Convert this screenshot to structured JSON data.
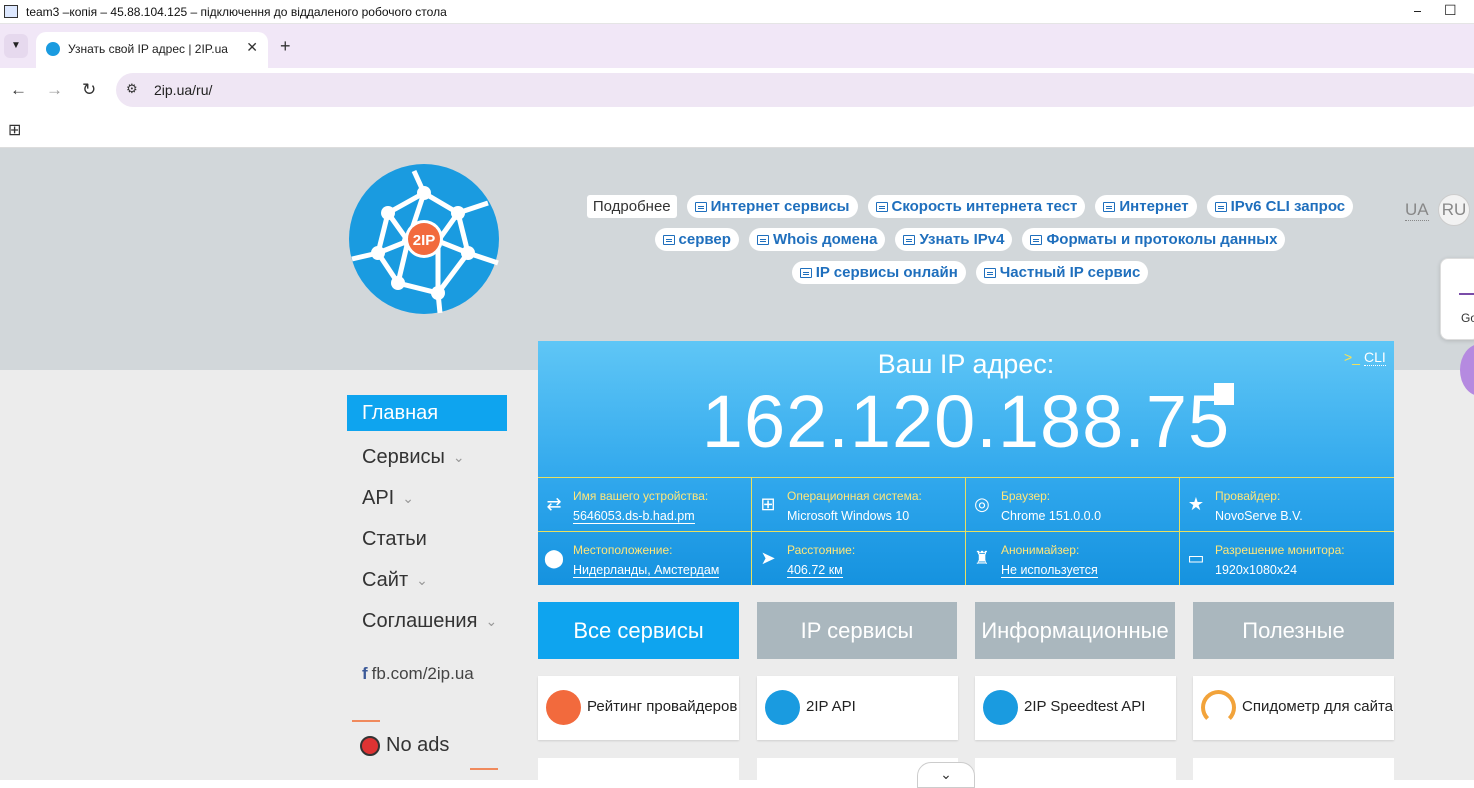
{
  "window": {
    "title": "team3 –копія – 45.88.104.125 – підключення до віддаленого робочого стола",
    "controls": [
      "⎯",
      "☐"
    ]
  },
  "browser": {
    "tab_title": "Узнать свой IP адрес | 2IP.ua",
    "tab_close": "✕",
    "new_tab": "+",
    "url": "2ip.ua/ru/",
    "back": "←",
    "forward": "→",
    "reload": "↻",
    "side_panel_text": "Go"
  },
  "header": {
    "logo_text": "2IP",
    "nav_rows": [
      [
        {
          "label": "Подробнее",
          "plain": true
        },
        {
          "label": "Интернет сервисы"
        },
        {
          "label": "Скорость интернета тест"
        },
        {
          "label": "Интернет"
        },
        {
          "label": "IPv6 CLI запрос"
        }
      ],
      [
        {
          "label": "сервер"
        },
        {
          "label": "Whois домена"
        },
        {
          "label": "Узнать IPv4"
        },
        {
          "label": "Форматы и протоколы данных"
        }
      ],
      [
        {
          "label": "IP сервисы онлайн"
        },
        {
          "label": "Частный IP сервис"
        }
      ]
    ],
    "lang_ua": "UA",
    "lang_ru": "RU"
  },
  "sidebar": {
    "items": [
      {
        "label": "Главная",
        "active": true,
        "chevron": false
      },
      {
        "label": "Сервисы",
        "chevron": true
      },
      {
        "label": "API",
        "chevron": true
      },
      {
        "label": "Статьи",
        "chevron": false
      },
      {
        "label": "Сайт",
        "chevron": true
      },
      {
        "label": "Соглашения",
        "chevron": true
      }
    ],
    "facebook": "fb.com/2ip.ua",
    "no_ads": "No ads"
  },
  "ip_panel": {
    "title": "Ваш IP адрес:",
    "ip": "162.120.188.75",
    "cli_label": "CLI",
    "cells": [
      {
        "icon": "device-icon",
        "glyph": "⇄",
        "label": "Имя вашего устройства:",
        "value": "5646053.ds-b.had.pm",
        "link": true
      },
      {
        "icon": "windows-icon",
        "glyph": "⊞",
        "label": "Операционная система:",
        "value": "Microsoft Windows 10",
        "link": false
      },
      {
        "icon": "browser-icon",
        "glyph": "◎",
        "label": "Браузер:",
        "value": "Chrome 151.0.0.0",
        "link": false
      },
      {
        "icon": "provider-icon",
        "glyph": "★",
        "label": "Провайдер:",
        "value": "NovoServe B.V.",
        "link": false
      },
      {
        "icon": "location-icon",
        "glyph": "⬤",
        "label": "Местоположение:",
        "value": "Нидерланды, Амстердам",
        "link": true
      },
      {
        "icon": "distance-icon",
        "glyph": "➤",
        "label": "Расстояние:",
        "value": "406.72 км",
        "link": true
      },
      {
        "icon": "anonymizer-icon",
        "glyph": "♜",
        "label": "Анонимайзер:",
        "value": "Не используется",
        "link": true
      },
      {
        "icon": "monitor-icon",
        "glyph": "▭",
        "label": "Разрешение монитора:",
        "value": "1920x1080x24",
        "link": false
      }
    ]
  },
  "service_tabs": [
    {
      "label": "Все сервисы",
      "active": true
    },
    {
      "label": "IP сервисы",
      "active": false
    },
    {
      "label": "Информационные",
      "active": false
    },
    {
      "label": "Полезные",
      "active": false
    }
  ],
  "cards": [
    {
      "label": "Рейтинг провайдеров",
      "color": "#f26a3d"
    },
    {
      "label": "2IP API",
      "color": "#1a9be0"
    },
    {
      "label": "2IP Speedtest API",
      "color": "#1a9be0"
    },
    {
      "label": "Спидометр для сайта",
      "color": "#ffffff"
    }
  ],
  "scroll_down": "⌄"
}
